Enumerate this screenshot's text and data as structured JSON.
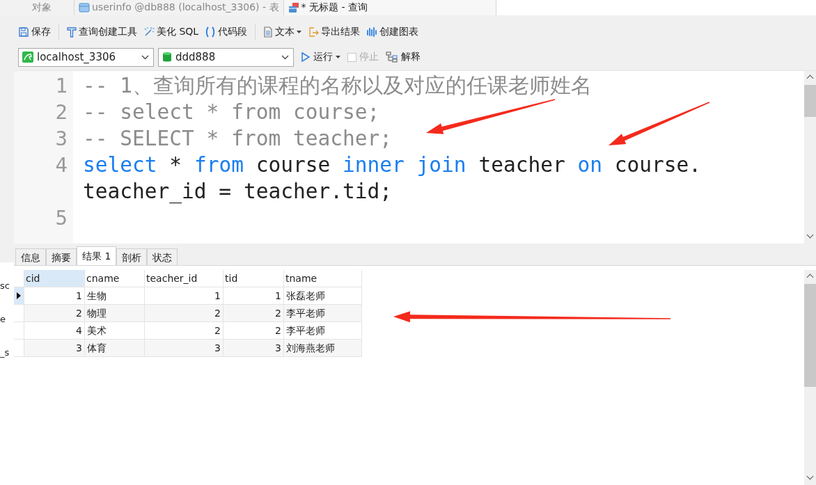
{
  "tabs": [
    {
      "label": "对象",
      "selected": false,
      "kind": "plain"
    },
    {
      "label": "userinfo @db888 (localhost_3306) - 表",
      "selected": false,
      "kind": "table"
    },
    {
      "label": "* 无标题 - 查询",
      "selected": true,
      "kind": "query"
    }
  ],
  "sidebar": {
    "items": [
      "sc",
      "e",
      "_s"
    ]
  },
  "toolbar": [
    {
      "kind": "save",
      "label": "保存"
    },
    {
      "kind": "divider"
    },
    {
      "kind": "builder",
      "label": "查询创建工具"
    },
    {
      "kind": "beautify",
      "label": "美化 SQL"
    },
    {
      "kind": "snippet",
      "label": "代码段"
    },
    {
      "kind": "divider"
    },
    {
      "kind": "text",
      "label": "文本",
      "dropdown": true
    },
    {
      "kind": "export",
      "label": "导出结果"
    },
    {
      "kind": "chart",
      "label": "创建图表"
    }
  ],
  "connection": {
    "server": "localhost_3306",
    "database": "ddd888"
  },
  "run_bar": [
    {
      "kind": "run",
      "label": "运行",
      "dropdown": true,
      "disabled": false
    },
    {
      "kind": "stop",
      "label": "停止",
      "disabled": true
    },
    {
      "kind": "explain",
      "label": "解释",
      "disabled": false
    }
  ],
  "editor": {
    "lines": [
      {
        "number": "1",
        "tokens": [
          {
            "kind": "comment",
            "text": "-- 1、查询所有的课程的名称以及对应的任课老师姓名"
          }
        ]
      },
      {
        "number": "2",
        "tokens": [
          {
            "kind": "comment",
            "text": "-- select * from course;"
          }
        ]
      },
      {
        "number": "3",
        "tokens": [
          {
            "kind": "comment",
            "text": "-- SELECT * from teacher;"
          }
        ]
      },
      {
        "number": "4",
        "tokens": [
          {
            "kind": "keyword",
            "text": "select"
          },
          {
            "kind": "plain",
            "text": " * "
          },
          {
            "kind": "keyword",
            "text": "from"
          },
          {
            "kind": "plain",
            "text": " course "
          },
          {
            "kind": "keyword",
            "text": "inner join"
          },
          {
            "kind": "plain",
            "text": " teacher "
          },
          {
            "kind": "keyword",
            "text": "on"
          },
          {
            "kind": "plain",
            "text": " course."
          }
        ]
      },
      {
        "tokens": [
          {
            "kind": "plain",
            "text": "teacher_id = teacher.tid;"
          }
        ]
      },
      {
        "number": "5"
      }
    ]
  },
  "result_tabs": [
    {
      "label": "信息",
      "selected": false
    },
    {
      "label": "摘要",
      "selected": false
    },
    {
      "label": "结果 1",
      "selected": true
    },
    {
      "label": "剖析",
      "selected": false
    },
    {
      "label": "状态",
      "selected": false
    }
  ],
  "grid": {
    "columns": [
      {
        "label": "cid",
        "kind": "number",
        "selected": true
      },
      {
        "label": "cname",
        "kind": "text",
        "selected": false
      },
      {
        "label": "teacher_id",
        "kind": "number",
        "selected": false
      },
      {
        "label": "tid",
        "kind": "number",
        "selected": false
      },
      {
        "label": "tname",
        "kind": "text",
        "selected": false
      }
    ],
    "rows": [
      {
        "selected": true,
        "cells": [
          "1",
          "生物",
          "1",
          "1",
          "张磊老师"
        ]
      },
      {
        "selected": false,
        "cells": [
          "2",
          "物理",
          "2",
          "2",
          "李平老师"
        ]
      },
      {
        "selected": false,
        "cells": [
          "4",
          "美术",
          "2",
          "2",
          "李平老师"
        ]
      },
      {
        "selected": false,
        "cells": [
          "3",
          "体育",
          "3",
          "3",
          "刘海燕老师"
        ]
      }
    ]
  },
  "annotation_arrows": [
    {
      "color": "#f42a1c"
    },
    {
      "color": "#f42a1c"
    },
    {
      "color": "#f42a1c"
    }
  ]
}
